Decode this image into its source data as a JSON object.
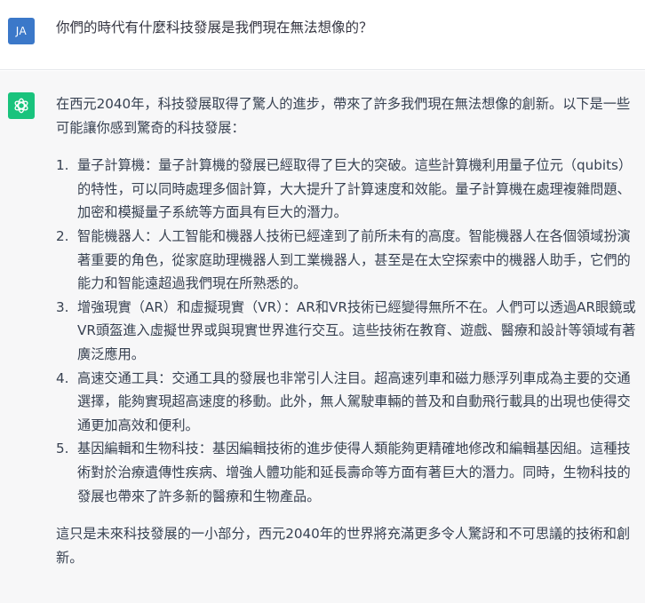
{
  "user": {
    "avatar_initials": "JA",
    "message": "你們的時代有什麼科技發展是我們現在無法想像的？"
  },
  "assistant": {
    "avatar_icon": "openai-logo-icon",
    "intro": "在西元2040年，科技發展取得了驚人的進步，帶來了許多我們現在無法想像的創新。以下是一些可能讓你感到驚奇的科技發展：",
    "items": [
      {
        "num": "1.",
        "text": "量子計算機：量子計算機的發展已經取得了巨大的突破。這些計算機利用量子位元（qubits）的特性，可以同時處理多個計算，大大提升了計算速度和效能。量子計算機在處理複雜問題、加密和模擬量子系統等方面具有巨大的潛力。"
      },
      {
        "num": "2.",
        "text": "智能機器人：人工智能和機器人技術已經達到了前所未有的高度。智能機器人在各個領域扮演著重要的角色，從家庭助理機器人到工業機器人，甚至是在太空探索中的機器人助手，它們的能力和智能遠超過我們現在所熟悉的。"
      },
      {
        "num": "3.",
        "text": "增強現實（AR）和虛擬現實（VR）：AR和VR技術已經變得無所不在。人們可以透過AR眼鏡或VR頭盔進入虛擬世界或與現實世界進行交互。這些技術在教育、遊戲、醫療和設計等領域有著廣泛應用。"
      },
      {
        "num": "4.",
        "text": "高速交通工具：交通工具的發展也非常引人注目。超高速列車和磁力懸浮列車成為主要的交通選擇，能夠實現超高速度的移動。此外，無人駕駛車輛的普及和自動飛行載具的出現也使得交通更加高效和便利。"
      },
      {
        "num": "5.",
        "text": "基因編輯和生物科技：基因編輯技術的進步使得人類能夠更精確地修改和編輯基因組。這種技術對於治療遺傳性疾病、增強人體功能和延長壽命等方面有著巨大的潛力。同時，生物科技的發展也帶來了許多新的醫療和生物產品。"
      }
    ],
    "outro": "這只是未來科技發展的一小部分，西元2040年的世界將充滿更多令人驚訝和不可思議的技術和創新。"
  },
  "colors": {
    "user_avatar": "#3b78c9",
    "assistant_avatar": "#19c37d",
    "assistant_background": "#f7f7f8",
    "text": "#374151"
  }
}
